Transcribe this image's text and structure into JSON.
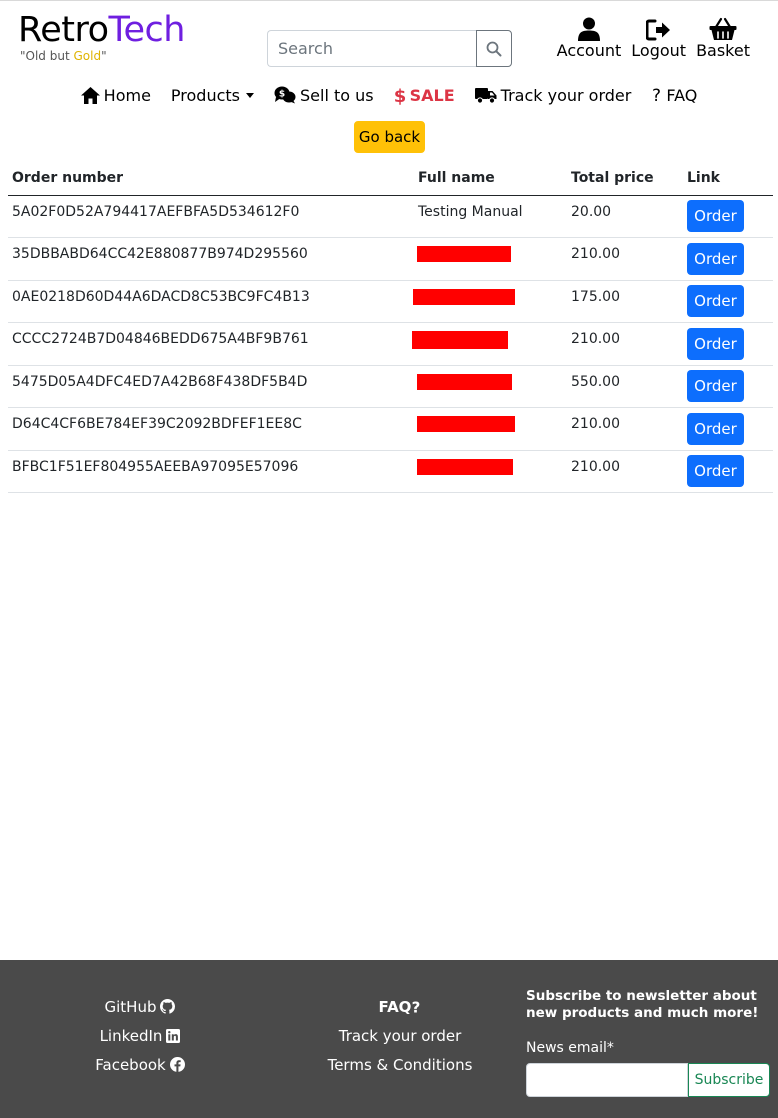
{
  "brand": {
    "part1": "Retro",
    "part2": "Tech",
    "tag_open": "\"Old but ",
    "tag_gold": "Gold",
    "tag_close": "\""
  },
  "search": {
    "placeholder": "Search"
  },
  "top_actions": {
    "account": "Account",
    "logout": "Logout",
    "basket": "Basket"
  },
  "nav": {
    "home": "Home",
    "products": "Products",
    "sell": "Sell to us",
    "sale": "SALE",
    "track": "Track your order",
    "faq": "FAQ"
  },
  "go_back": "Go back",
  "table": {
    "headers": {
      "order": "Order number",
      "name": "Full name",
      "price": "Total price",
      "link": "Link"
    },
    "button_label": "Order",
    "rows": [
      {
        "order": "5A02F0D52A794417AEFBFA5D534612F0",
        "name": "Testing Manual",
        "price": "20.00"
      },
      {
        "order": "35DBBABD64CC42E880877B974D295560",
        "name": "",
        "price": "210.00"
      },
      {
        "order": "0AE0218D60D44A6DACD8C53BC9FC4B13",
        "name": "",
        "price": "175.00"
      },
      {
        "order": "CCCC2724B7D04846BEDD675A4BF9B761",
        "name": "",
        "price": "210.00"
      },
      {
        "order": "5475D05A4DFC4ED7A42B68F438DF5B4D",
        "name": "",
        "price": "550.00"
      },
      {
        "order": "D64C4CF6BE784EF39C2092BDFEF1EE8C",
        "name": "",
        "price": "210.00"
      },
      {
        "order": "BFBC1F51EF804955AEEBA97095E57096",
        "name": "",
        "price": "210.00"
      }
    ]
  },
  "footer": {
    "github": "GitHub",
    "linkedin": "LinkedIn",
    "facebook": "Facebook",
    "faq": "FAQ",
    "track": "Track your order",
    "terms": "Terms & Conditions",
    "news_title": "Subscribe to newsletter about new products and much more!",
    "news_label": "News email*",
    "subscribe": "Subscribe"
  },
  "colors": {
    "brand_purple": "#6f1fe0",
    "gold": "#e0b400",
    "sale_red": "#dc3545",
    "primary": "#0d6efd",
    "warning": "#ffc107",
    "footer_bg": "#4a4a4a",
    "success": "#198754",
    "redaction": "#ff0000"
  }
}
